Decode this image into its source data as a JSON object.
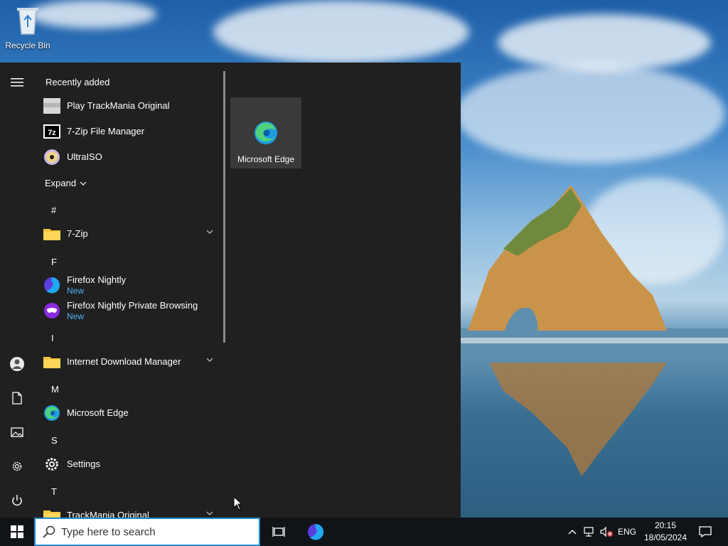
{
  "desktop": {
    "icons": [
      {
        "label": "Recycle Bin",
        "icon": "recycle-bin-icon"
      }
    ]
  },
  "start_menu": {
    "recently_added_title": "Recently added",
    "recent": [
      {
        "label": "Play TrackMania Original",
        "icon": "trackmania-icon"
      },
      {
        "label": "7-Zip File Manager",
        "icon": "7zip-icon"
      },
      {
        "label": "UltraISO",
        "icon": "ultraiso-icon"
      }
    ],
    "expand_label": "Expand",
    "groups": {
      "hash": "#",
      "f": "F",
      "i": "I",
      "m": "M",
      "s": "S",
      "t": "T"
    },
    "apps": {
      "sevenzip": "7-Zip",
      "firefox_nightly": "Firefox Nightly",
      "firefox_nightly_badge": "New",
      "firefox_private": "Firefox Nightly Private Browsing",
      "firefox_private_badge": "New",
      "idm": "Internet Download Manager",
      "edge": "Microsoft Edge",
      "settings": "Settings",
      "trackmania": "TrackMania Original"
    },
    "tiles": [
      {
        "label": "Microsoft Edge",
        "icon": "edge-icon"
      }
    ],
    "rail": [
      "menu-icon",
      "user-icon",
      "documents-icon",
      "pictures-icon",
      "settings-icon",
      "power-icon"
    ]
  },
  "taskbar": {
    "search_placeholder": "Type here to search",
    "language": "ENG",
    "time": "20:15",
    "date": "18/05/2024"
  },
  "colors": {
    "start_menu_bg": "#202020",
    "taskbar_bg": "#101418",
    "accent": "#1f8ad2",
    "new_badge": "#4fb3f5"
  }
}
